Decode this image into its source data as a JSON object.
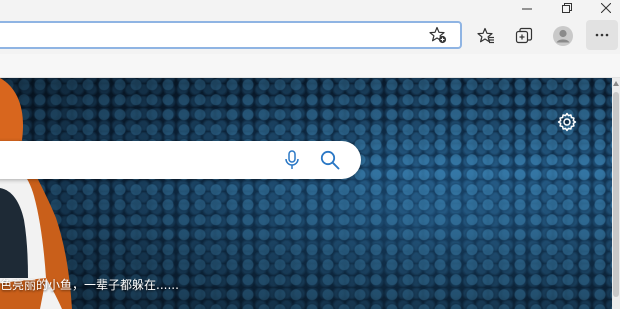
{
  "window": {
    "minimize_icon": "minimize-icon",
    "restore_icon": "restore-icon",
    "close_icon": "close-icon"
  },
  "toolbar": {
    "address_value": "",
    "favorites_add_icon": "star-add-icon",
    "favorites_icon": "favorites-icon",
    "collections_icon": "collections-icon",
    "profile_icon": "profile-icon",
    "menu_icon": "more-icon"
  },
  "newtab": {
    "search_placeholder": "",
    "mic_icon": "microphone-icon",
    "search_icon": "search-icon",
    "settings_icon": "gear-icon",
    "caption": "色亮丽的小鱼，一辈子都躲在......"
  },
  "colors": {
    "accent": "#2b78c5",
    "chrome": "#f3f3f3",
    "page_bg": "#0f2c47"
  }
}
